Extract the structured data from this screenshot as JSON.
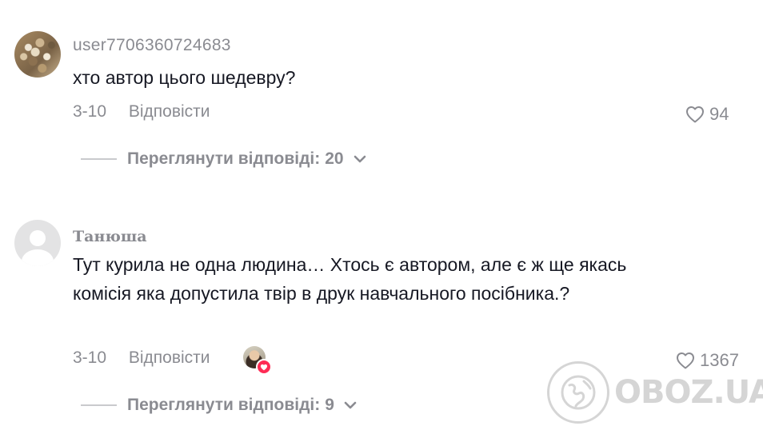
{
  "comments": [
    {
      "username": "user7706360724683",
      "text": "хто автор цього шедевру?",
      "date": "3-10",
      "reply_label": "Відповісти",
      "likes": "94",
      "view_replies_label": "Переглянути відповіді:",
      "view_replies_count": "20",
      "avatar": "photo"
    },
    {
      "username": "Танюша",
      "text": "Тут курила не одна людина… Хтось є автором, але є ж ще якась комісія яка допустила твір в друк навчального посібника.?",
      "date": "3-10",
      "reply_label": "Відповісти",
      "likes": "1367",
      "view_replies_label": "Переглянути відповіді:",
      "view_replies_count": "9",
      "avatar": "default",
      "creator_liked": true
    }
  ],
  "watermark": {
    "text": "OBOZ.UA"
  },
  "colors": {
    "text_primary": "#161823",
    "text_secondary": "#8a8b91",
    "heart_badge": "#fe2c55"
  },
  "icons": {
    "like": "heart-outline-icon",
    "expand": "chevron-down-icon",
    "liked_badge": "heart-filled-icon"
  }
}
